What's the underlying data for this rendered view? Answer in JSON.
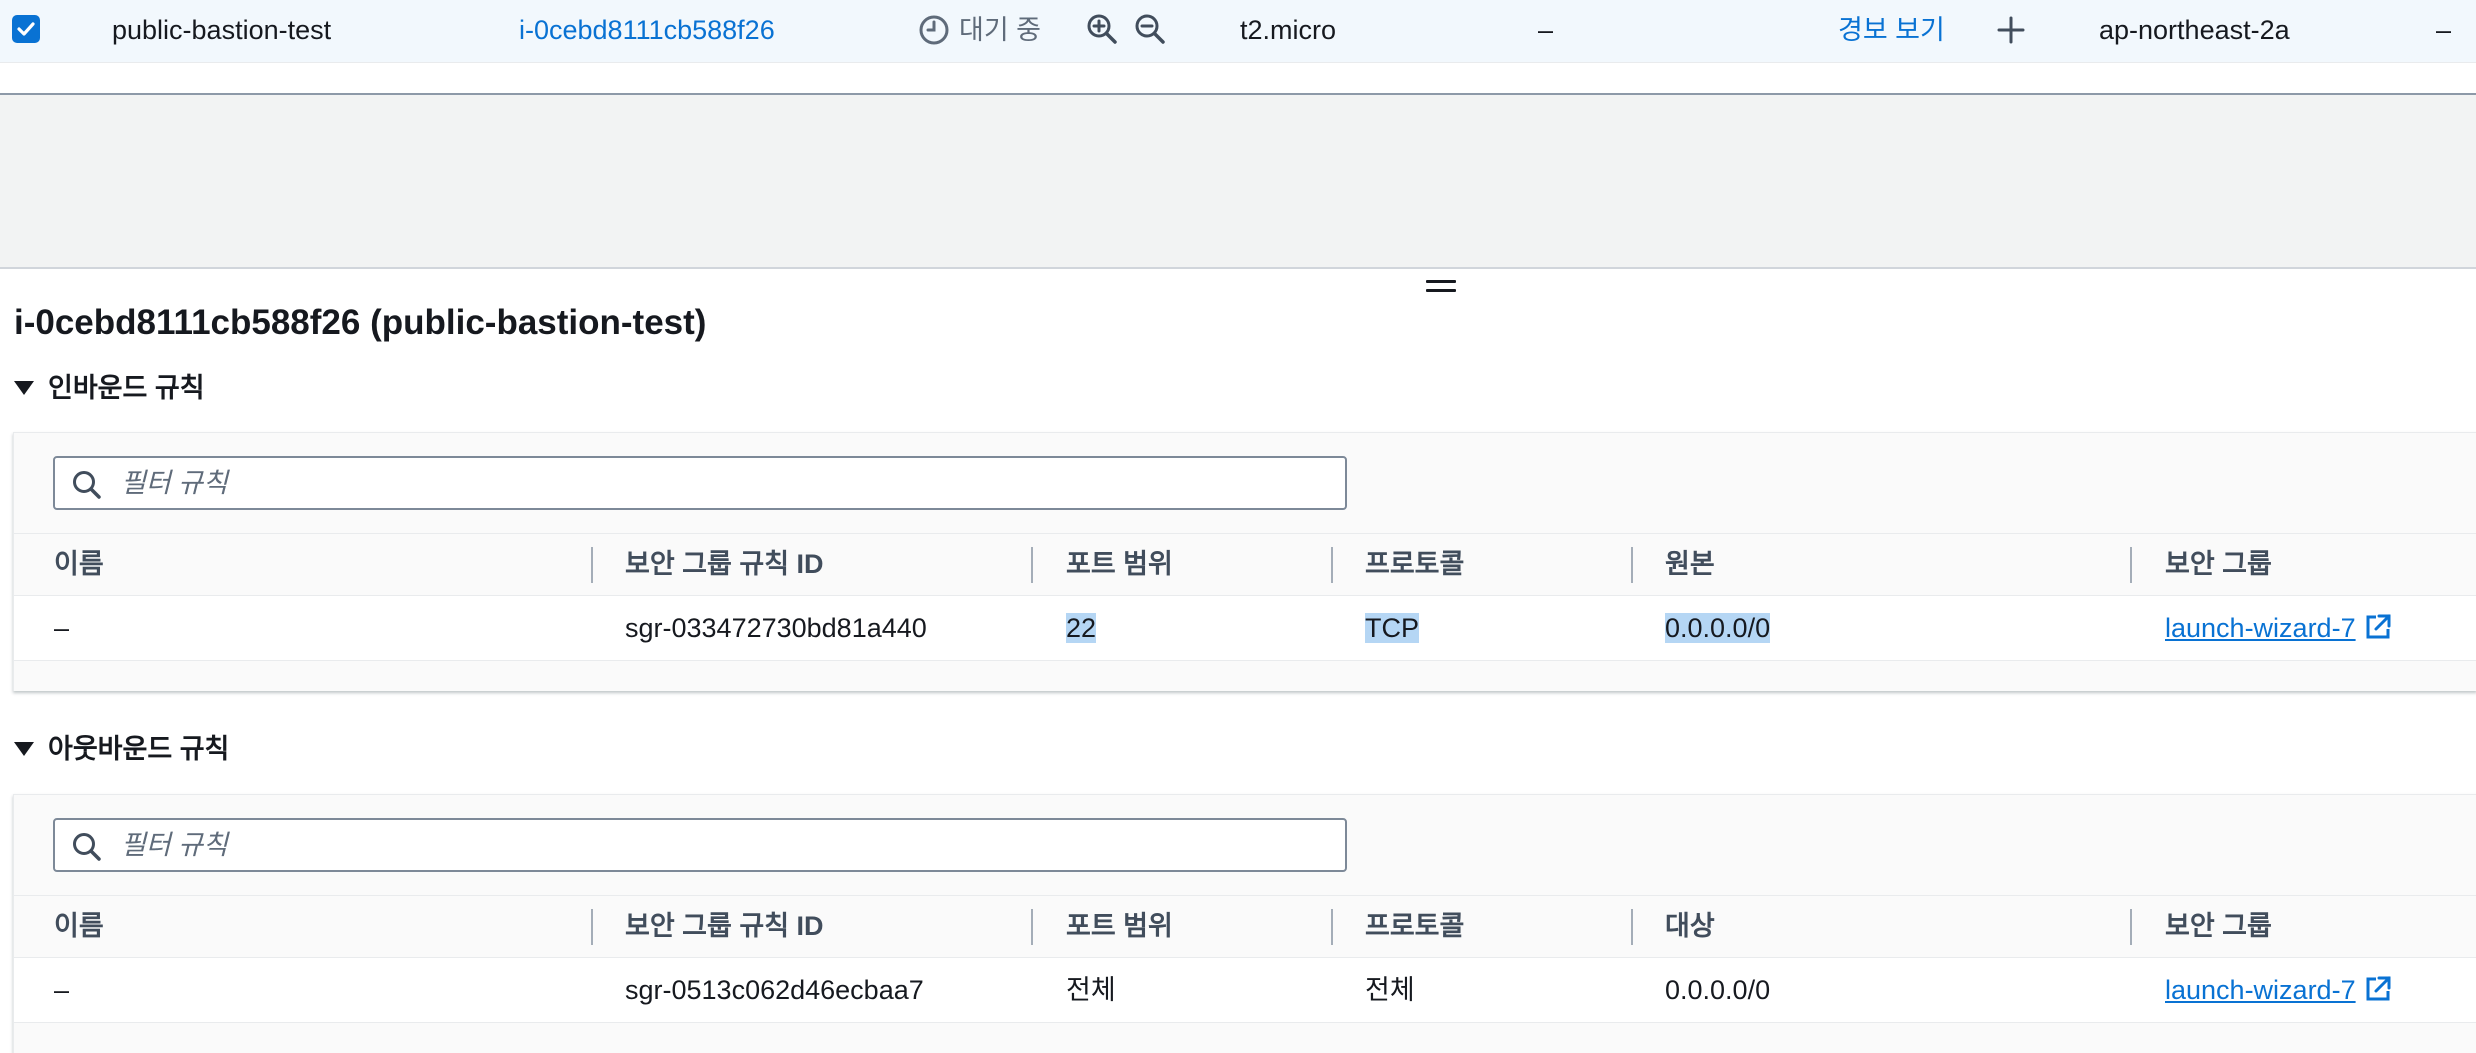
{
  "instance_row": {
    "name": "public-bastion-test",
    "instance_id": "i-0cebd8111cb588f26",
    "state": "대기 중",
    "type": "t2.micro",
    "status_check": "–",
    "alarm": "경보 보기",
    "az": "ap-northeast-2a",
    "public_dns": "–"
  },
  "panel": {
    "title": "i-0cebd8111cb588f26 (public-bastion-test)"
  },
  "inbound": {
    "title": "인바운드 규칙",
    "filter_placeholder": "필터 규칙",
    "columns": [
      "이름",
      "보안 그룹 규칙 ID",
      "포트 범위",
      "프로토콜",
      "원본",
      "보안 그룹"
    ],
    "rows": [
      {
        "name": "–",
        "rule_id": "sgr-033472730bd81a440",
        "port": "22",
        "protocol": "TCP",
        "source": "0.0.0.0/0",
        "security_group": "launch-wizard-7"
      }
    ]
  },
  "outbound": {
    "title": "아웃바운드 규칙",
    "filter_placeholder": "필터 규칙",
    "columns": [
      "이름",
      "보안 그룹 규칙 ID",
      "포트 범위",
      "프로토콜",
      "대상",
      "보안 그룹"
    ],
    "rows": [
      {
        "name": "–",
        "rule_id": "sgr-0513c062d46ecbaa7",
        "port": "전체",
        "protocol": "전체",
        "destination": "0.0.0.0/0",
        "security_group": "launch-wizard-7"
      }
    ]
  },
  "colors": {
    "link": "#0972d3",
    "selection": "#b5d6f4",
    "header_text": "#414d5c"
  },
  "icons": [
    "checkbox-checked-icon",
    "clock-icon",
    "zoom-in-icon",
    "zoom-out-icon",
    "plus-icon",
    "drag-handle-icon",
    "caret-down-icon",
    "search-icon",
    "external-link-icon"
  ]
}
